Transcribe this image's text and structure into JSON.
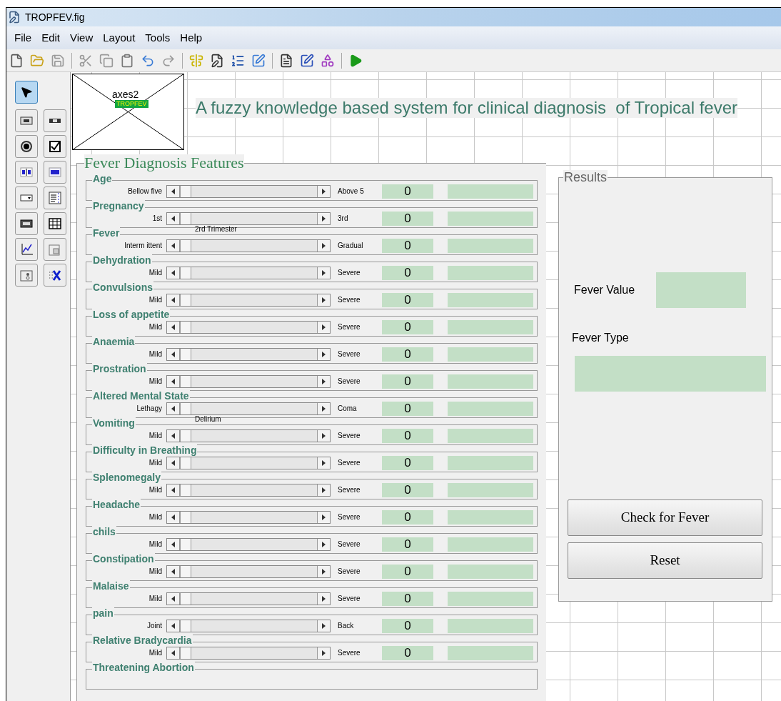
{
  "window": {
    "title": "TROPFEV.fig"
  },
  "menu": [
    "File",
    "Edit",
    "View",
    "Layout",
    "Tools",
    "Help"
  ],
  "palette": [
    {
      "kind": "select",
      "selected": true
    },
    {
      "kind": "push",
      "selected": false
    },
    {
      "kind": "slider",
      "selected": false
    },
    {
      "kind": "radio",
      "selected": false
    },
    {
      "kind": "check",
      "selected": false
    },
    {
      "kind": "edit",
      "selected": false
    },
    {
      "kind": "text",
      "selected": false
    },
    {
      "kind": "popup",
      "selected": false
    },
    {
      "kind": "list",
      "selected": false
    },
    {
      "kind": "toggle",
      "selected": false
    },
    {
      "kind": "table",
      "selected": false
    },
    {
      "kind": "axes",
      "selected": false
    },
    {
      "kind": "panel",
      "selected": false
    },
    {
      "kind": "group",
      "selected": false
    },
    {
      "kind": "activex",
      "selected": false
    }
  ],
  "axes": {
    "label": "axes2",
    "tag": "TROPFEV"
  },
  "heading": "A fuzzy knowledge based system for clinical diagnosis  of Tropical fever",
  "features": {
    "title": "Fever Diagnosis Features",
    "rows": [
      {
        "label": "Age",
        "low": "Bellow five",
        "high": "Above 5",
        "level": 0,
        "value": "0"
      },
      {
        "label": "Pregnancy",
        "low": "1st",
        "high": "3rd",
        "middle": "2rd Trimester",
        "level": 0,
        "value": "0"
      },
      {
        "label": "Fever",
        "low": "Interm ittent",
        "high": "Gradual",
        "level": 0,
        "value": "0"
      },
      {
        "label": "Dehydration",
        "low": "Mild",
        "high": "Severe",
        "level": 0,
        "value": "0"
      },
      {
        "label": "Convulsions",
        "low": "Mild",
        "high": "Severe",
        "level": 0,
        "value": "0"
      },
      {
        "label": "Loss of appetite",
        "low": "Mild",
        "high": "Severe",
        "level": 0,
        "value": "0"
      },
      {
        "label": "Anaemia",
        "low": "Mild",
        "high": "Severe",
        "level": 0,
        "value": "0"
      },
      {
        "label": "Prostration",
        "low": "Mild",
        "high": "Severe",
        "level": 0,
        "value": "0"
      },
      {
        "label": "Altered Mental State",
        "low": "Lethagy",
        "high": "Coma",
        "middle": "Delirium",
        "level": 0,
        "value": "0"
      },
      {
        "label": "Vomiting",
        "low": "Mild",
        "high": "Severe",
        "level": 0,
        "value": "0"
      },
      {
        "label": "Difficulty in Breathing",
        "low": "Mild",
        "high": "Severe",
        "level": 0,
        "value": "0"
      },
      {
        "label": "Splenomegaly",
        "low": "Mild",
        "high": "Severe",
        "level": 0,
        "value": "0"
      },
      {
        "label": "Headache",
        "low": "Mild",
        "high": "Severe",
        "level": 0,
        "value": "0"
      },
      {
        "label": "chils",
        "low": "Mild",
        "high": "Severe",
        "level": 0,
        "value": "0"
      },
      {
        "label": "Constipation",
        "low": "Mild",
        "high": "Severe",
        "level": 0,
        "value": "0"
      },
      {
        "label": "Malaise",
        "low": "Mild",
        "high": "Severe",
        "level": 0,
        "value": "0"
      },
      {
        "label": "pain",
        "low": "Joint",
        "high": "Back",
        "level": 0,
        "value": "0"
      },
      {
        "label": "Relative Bradycardia",
        "low": "Mild",
        "high": "Severe",
        "level": 0,
        "value": "0"
      },
      {
        "label": "Threatening Abortion"
      }
    ]
  },
  "results": {
    "title": "Results",
    "fever_value_label": "Fever Value",
    "fever_type_label": "Fever Type",
    "buttons": [
      "Check for Fever",
      "Reset"
    ]
  }
}
